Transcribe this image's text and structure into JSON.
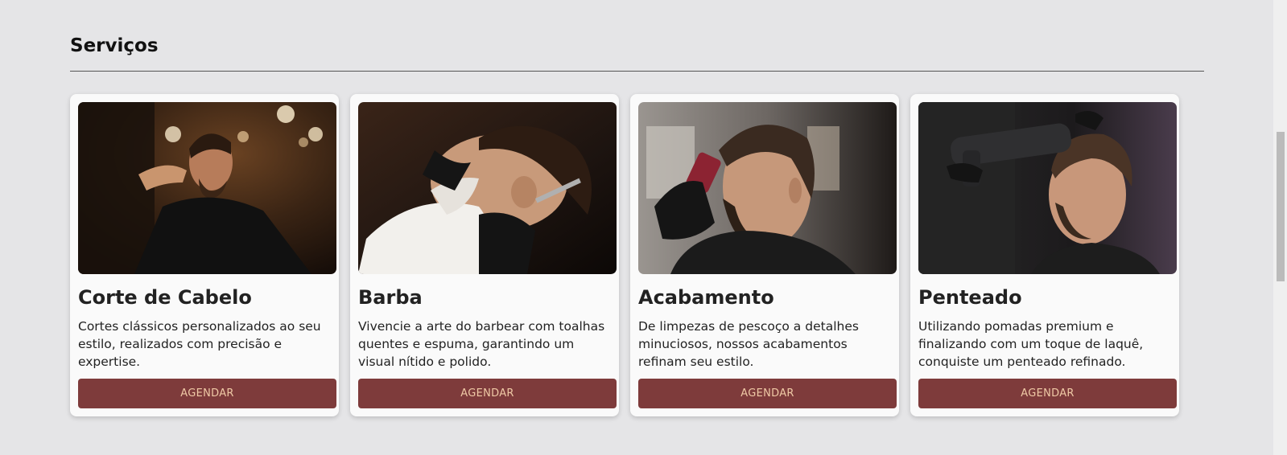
{
  "section": {
    "title": "Serviços"
  },
  "services": [
    {
      "title": "Corte de Cabelo",
      "description": "Cortes clássicos personalizados ao seu estilo, realizados com precisão e expertise.",
      "button": "AGENDAR",
      "image": "haircut-photo"
    },
    {
      "title": "Barba",
      "description": "Vivencie a arte do barbear com toalhas quentes e espuma, garantindo um visual nítido e polido.",
      "button": "AGENDAR",
      "image": "beard-shave-photo"
    },
    {
      "title": "Acabamento",
      "description": "De limpezas de pescoço a detalhes minuciosos, nossos acabamentos refinam seu estilo.",
      "button": "AGENDAR",
      "image": "trimming-photo"
    },
    {
      "title": "Penteado",
      "description": "Utilizando pomadas premium e finalizando com um toque de laquê, conquiste um penteado refinado.",
      "button": "AGENDAR",
      "image": "hairstyling-photo"
    }
  ],
  "colors": {
    "background": "#e5e5e7",
    "card": "#fafafa",
    "button": "#7e3b3b",
    "button_text": "#efc9a5"
  }
}
